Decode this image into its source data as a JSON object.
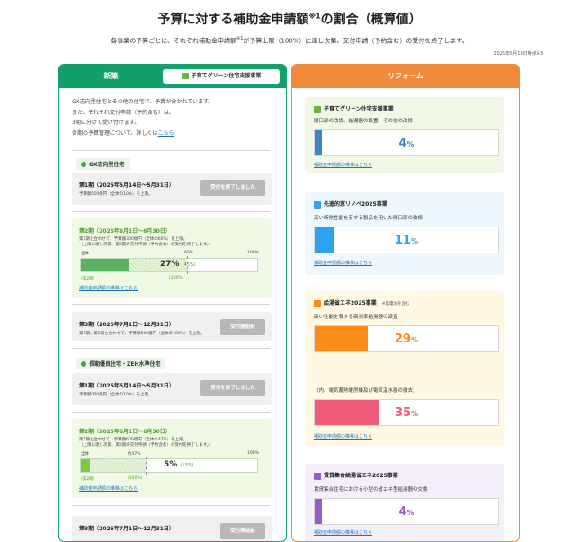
{
  "header": {
    "title_main": "予算に対する補助金申請額",
    "title_sup": "※1",
    "title_tail": "の割合（概算値）",
    "subtitle_pre": "各事業の予算ごとに、それぞれ補助金申請額",
    "subtitle_sup": "※1",
    "subtitle_post": "が予算上限（100%）に達し次第、交付申請（予約含む）の受付を終了します。",
    "as_of": "2025年6月19日時点※3"
  },
  "left": {
    "header_label": "新築",
    "tag_label": "子育てグリーン住宅支援事業",
    "intro": [
      "GX志向型住宅とその他の住宅で、予算が分かれています。",
      "また、それぞれ交付申請（予約含む）は、",
      "3期に分けて受け付けます。",
      "各期の予算管理について、詳しくは"
    ],
    "intro_link": "こちら",
    "sections": [
      {
        "heading": "GX志向型住宅",
        "p1_title": "第1期（2025年5月14日～5月31日）",
        "p1_desc": "予算額150億円（全体の10%）を上限。",
        "p1_btn": "受付を終了しました",
        "p2_title": "第2期（2025年6月1日～6月30日）",
        "p2_desc1": "第1期と合わせて、予算額300億円（全体の60%）を上限。",
        "p2_desc2": "（上限に達し次第、第2期の交付申請（予約含む）の受付を終了します。）",
        "p2_tick_all": "全体",
        "p2_tick_mid": "60%",
        "p2_tick_end": "100%",
        "p2_pct": "27%",
        "p2_pct_sub": "(45%)",
        "p2_sub_period": "(第2期)",
        "p2_sub_100": "(100%)",
        "p2_link": "補助金申請額の推移はこちら",
        "p3_title": "第3期（2025年7月1日～12月31日）",
        "p3_desc": "第1期、第2期と合わせて、予算額500億円（全体の100%）を上限。",
        "p3_btn": "受付開始前",
        "progress": 27,
        "limit": 60
      },
      {
        "heading": "長期優良住宅・ZEH水準住宅",
        "p1_title": "第1期（2025年5月14日～5月31日）",
        "p1_desc": "予算額300億円（全体の10%）を上限。",
        "p1_btn": "受付を終了しました",
        "p2_title": "第2期（2025年6月1日～6月30日）",
        "p2_desc1": "第1期と合わせて、予算額600億円（全体の37%）を上限。",
        "p2_desc2": "（上限に達し次第、第2期の交付申請（予約含む）の受付を終了します。）",
        "p2_tick_all": "全体",
        "p2_tick_mid": "約37%",
        "p2_tick_end": "100%",
        "p2_pct": "5%",
        "p2_pct_sub": "(13%)",
        "p2_sub_period": "(第2期)",
        "p2_sub_100": "(100%)",
        "p2_link": "補助金申請額の推移はこちら",
        "p3_title": "第3期（2025年7月1日～12月31日）",
        "p3_btn": "受付開始前",
        "progress": 5,
        "limit": 37
      }
    ]
  },
  "right": {
    "header_label": "リフォーム",
    "cards": [
      {
        "title": "子育てグリーン住宅支援事業",
        "desc": "開口部の改修、給湯器の設置、その他の改修",
        "pct_num": "4",
        "pct_unit": "%",
        "link": "補助金申請額の推移はこちら",
        "value": 4,
        "bg": "#f1f9e6",
        "fill": "#3d85c6",
        "text_color": "#3d85c6",
        "icon_color": "#6bb536"
      },
      {
        "title": "先進的窓リノベ2025事業",
        "desc": "高い断熱性能を有する製品を用いた開口部の改修",
        "pct_num": "11",
        "pct_unit": "%",
        "link": "補助金申請額の推移はこちら",
        "value": 11,
        "bg": "#eef7fb",
        "fill": "#2ea3f2",
        "text_color": "#2ea3f2",
        "icon_color": "#2ea3f2"
      },
      {
        "title": "給湯省エネ2025事業",
        "note": "※蓄電池を含む",
        "desc": "高い性能を有する高効率給湯器の設置",
        "pct_num": "29",
        "pct_unit": "%",
        "link": "",
        "value": 29,
        "bg": "#fff8e3",
        "fill": "#fb8c1a",
        "text_color": "#fb8c1a",
        "icon_color": "#fb8c1a",
        "sub_label": "（内、電気蓄熱暖房機及び電気温水器の撤去）",
        "sub_pct_num": "35",
        "sub_pct_unit": "%",
        "sub_value": 35,
        "sub_fill": "#ef5d7a",
        "sub_text_color": "#ef5d7a",
        "sub_link": "補助金申請額の推移はこちら"
      },
      {
        "title": "賃貸集合給湯省エネ2025事業",
        "desc": "賃貸集合住宅における小型の省エネ型給湯器の交換",
        "pct_num": "4",
        "pct_unit": "%",
        "link": "補助金申請額の推移はこちら",
        "value": 4,
        "bg": "#f5effb",
        "fill": "#9b59d0",
        "text_color": "#9b59d0",
        "icon_color": "#9b59d0"
      }
    ]
  }
}
